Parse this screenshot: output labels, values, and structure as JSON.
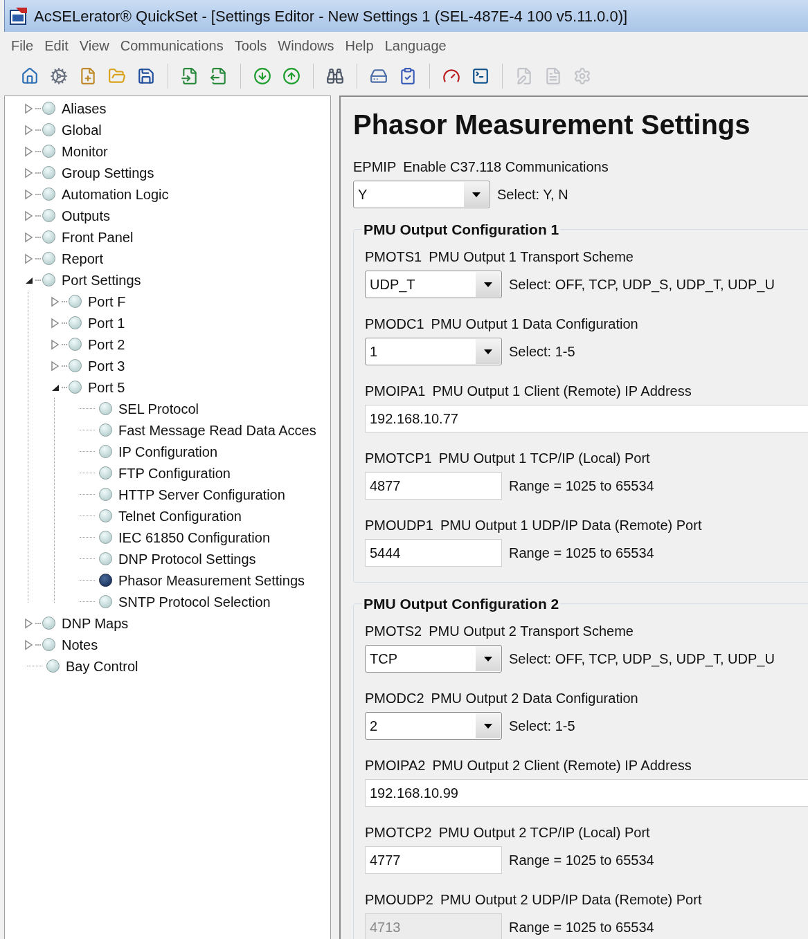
{
  "window": {
    "title": "AcSELerator® QuickSet - [Settings Editor - New Settings 1 (SEL-487E-4 100 v5.11.0.0)]"
  },
  "menu": [
    "File",
    "Edit",
    "View",
    "Communications",
    "Tools",
    "Windows",
    "Help",
    "Language"
  ],
  "toolbar": [
    [
      {
        "disabled": false
      },
      {
        "disabled": false
      },
      {
        "disabled": false
      },
      {
        "disabled": false
      },
      {
        "disabled": false
      }
    ],
    [
      {
        "disabled": false
      },
      {
        "disabled": false
      }
    ],
    [
      {
        "disabled": false
      },
      {
        "disabled": false
      }
    ],
    [
      {
        "disabled": false
      }
    ],
    [
      {
        "disabled": false
      },
      {
        "disabled": false
      }
    ],
    [
      {
        "disabled": false
      },
      {
        "disabled": false
      }
    ],
    [
      {
        "disabled": true
      },
      {
        "disabled": true
      },
      {
        "disabled": true
      }
    ]
  ],
  "tree": [
    {
      "label": "Aliases",
      "kind": "branch",
      "expanded": false,
      "selected": false
    },
    {
      "label": "Global",
      "kind": "branch",
      "expanded": false,
      "selected": false
    },
    {
      "label": "Monitor",
      "kind": "branch",
      "expanded": false,
      "selected": false
    },
    {
      "label": "Group Settings",
      "kind": "branch",
      "expanded": false,
      "selected": false
    },
    {
      "label": "Automation Logic",
      "kind": "branch",
      "expanded": false,
      "selected": false
    },
    {
      "label": "Outputs",
      "kind": "branch",
      "expanded": false,
      "selected": false
    },
    {
      "label": "Front Panel",
      "kind": "branch",
      "expanded": false,
      "selected": false
    },
    {
      "label": "Report",
      "kind": "branch",
      "expanded": false,
      "selected": false
    },
    {
      "label": "Port Settings",
      "kind": "branch",
      "expanded": true,
      "selected": false,
      "children": [
        {
          "label": "Port F",
          "kind": "branch",
          "expanded": false,
          "selected": false
        },
        {
          "label": "Port 1",
          "kind": "branch",
          "expanded": false,
          "selected": false
        },
        {
          "label": "Port 2",
          "kind": "branch",
          "expanded": false,
          "selected": false
        },
        {
          "label": "Port 3",
          "kind": "branch",
          "expanded": false,
          "selected": false
        },
        {
          "label": "Port 5",
          "kind": "branch",
          "expanded": true,
          "selected": false,
          "children": [
            {
              "label": "SEL Protocol",
              "kind": "leaf",
              "selected": false
            },
            {
              "label": "Fast Message Read Data Acces",
              "kind": "leaf",
              "selected": false
            },
            {
              "label": "IP Configuration",
              "kind": "leaf",
              "selected": false
            },
            {
              "label": "FTP Configuration",
              "kind": "leaf",
              "selected": false
            },
            {
              "label": "HTTP Server Configuration",
              "kind": "leaf",
              "selected": false
            },
            {
              "label": "Telnet Configuration",
              "kind": "leaf",
              "selected": false
            },
            {
              "label": "IEC 61850 Configuration",
              "kind": "leaf",
              "selected": false
            },
            {
              "label": "DNP Protocol Settings",
              "kind": "leaf",
              "selected": false
            },
            {
              "label": "Phasor Measurement Settings",
              "kind": "leaf",
              "selected": true
            },
            {
              "label": "SNTP Protocol Selection",
              "kind": "leaf",
              "selected": false
            }
          ]
        }
      ]
    },
    {
      "label": "DNP Maps",
      "kind": "branch",
      "expanded": false,
      "selected": false
    },
    {
      "label": "Notes",
      "kind": "branch",
      "expanded": false,
      "selected": false
    },
    {
      "label": "Bay Control",
      "kind": "leaf",
      "selected": false
    }
  ],
  "page": {
    "title": "Phasor Measurement Settings",
    "settings": [
      {
        "kind": "select",
        "code": "EPMIP",
        "label": "Enable C37.118 Communications",
        "value": "Y",
        "hint": "Select: Y, N",
        "disabled": false
      }
    ],
    "groups": [
      {
        "title": "PMU Output Configuration 1",
        "settings": [
          {
            "kind": "select",
            "code": "PMOTS1",
            "label": "PMU Output 1 Transport Scheme",
            "value": "UDP_T",
            "hint": "Select: OFF, TCP, UDP_S, UDP_T, UDP_U",
            "disabled": false
          },
          {
            "kind": "select",
            "code": "PMODC1",
            "label": "PMU Output 1 Data Configuration",
            "value": "1",
            "hint": "Select: 1-5",
            "disabled": false
          },
          {
            "kind": "wide",
            "code": "PMOIPA1",
            "label": "PMU Output 1 Client (Remote) IP Address",
            "value": "192.168.10.77",
            "disabled": false
          },
          {
            "kind": "number",
            "code": "PMOTCP1",
            "label": "PMU Output 1 TCP/IP (Local) Port",
            "value": "4877",
            "hint": "Range = 1025 to 65534",
            "disabled": false
          },
          {
            "kind": "number",
            "code": "PMOUDP1",
            "label": "PMU Output 1 UDP/IP Data (Remote) Port",
            "value": "5444",
            "hint": "Range = 1025 to 65534",
            "disabled": false
          }
        ]
      },
      {
        "title": "PMU Output Configuration 2",
        "settings": [
          {
            "kind": "select",
            "code": "PMOTS2",
            "label": "PMU Output 2 Transport Scheme",
            "value": "TCP",
            "hint": "Select: OFF, TCP, UDP_S, UDP_T, UDP_U",
            "disabled": false
          },
          {
            "kind": "select",
            "code": "PMODC2",
            "label": "PMU Output 2 Data Configuration",
            "value": "2",
            "hint": "Select: 1-5",
            "disabled": false
          },
          {
            "kind": "wide",
            "code": "PMOIPA2",
            "label": "PMU Output 2 Client (Remote) IP Address",
            "value": "192.168.10.99",
            "disabled": false
          },
          {
            "kind": "number",
            "code": "PMOTCP2",
            "label": "PMU Output 2 TCP/IP (Local) Port",
            "value": "4777",
            "hint": "Range = 1025 to 65534",
            "disabled": false
          },
          {
            "kind": "number",
            "code": "PMOUDP2",
            "label": "PMU Output 2 UDP/IP Data (Remote) Port",
            "value": "4713",
            "hint": "Range = 1025 to 65534",
            "disabled": true
          }
        ]
      }
    ]
  }
}
